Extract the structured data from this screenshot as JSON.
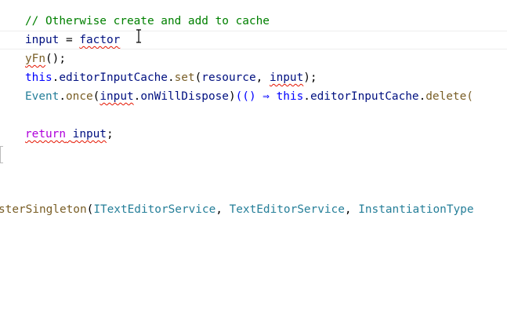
{
  "editor": {
    "lines": {
      "l1": {
        "comment": "// Otherwise create and add to cache"
      },
      "l2": {
        "var": "input",
        "op": " = ",
        "call": "factor"
      },
      "l3": {
        "fn": "yFn",
        "tail": "();"
      },
      "l4": {
        "kw": "this",
        "dot1": ".",
        "prop": "editorInputCache",
        "dot2": ".",
        "fn": "set",
        "open": "(",
        "arg1": "resource",
        "sep": ", ",
        "arg2": "input",
        "close": ");"
      },
      "l5": {
        "obj": "Event",
        "dot1": ".",
        "fn": "once",
        "open": "(",
        "arg": "input",
        "dot2": ".",
        "evt": "onWillDispose",
        "close": ")",
        "arrow": "(() ⇒ ",
        "kw": "this",
        "dot3": ".",
        "prop": "editorInputCache",
        "dot4": ".",
        "rest": "delete("
      },
      "l7": {
        "ret": "return",
        "sp": " ",
        "var": "input",
        "semi": ";"
      },
      "l11": {
        "fn": "sterSingleton",
        "open": "(",
        "a1": "ITextEditorService",
        "sep1": ", ",
        "a2": "TextEditorService",
        "sep2": ", ",
        "a3": "InstantiationType"
      }
    }
  }
}
